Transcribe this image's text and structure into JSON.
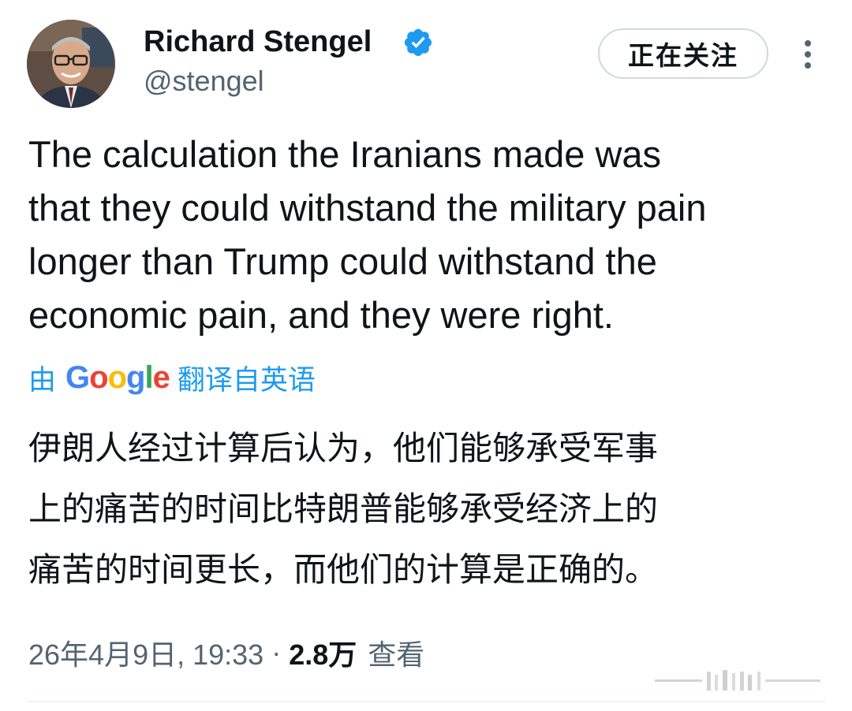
{
  "author": {
    "display_name": "Richard Stengel",
    "handle": "@stengel",
    "verified": true,
    "verified_icon": "verified-badge-icon",
    "verified_color": "#1d9bf0"
  },
  "header": {
    "follow_label": "正在关注",
    "more_icon": "more-vertical-icon"
  },
  "tweet": {
    "text_lines": [
      "The calculation the Iranians made was",
      "that they could withstand the military pain",
      "longer than Trump could withstand the",
      "economic pain, and they were right."
    ],
    "translation": {
      "prefix": "由",
      "provider": "Google",
      "suffix": "翻译自英语",
      "lines": [
        "伊朗人经过计算后认为，他们能够承受军事",
        "上的痛苦的时间比特朗普能够承受经济上的",
        "痛苦的时间更长，而他们的计算是正确的。"
      ]
    },
    "timestamp": "26年4月9日, 19:33",
    "separator": "·",
    "views_count": "2.8万",
    "views_label": "查看"
  },
  "colors": {
    "accent": "#1d9bf0",
    "text": "#0f1419",
    "secondary": "#536471",
    "border": "#cfd9de"
  }
}
